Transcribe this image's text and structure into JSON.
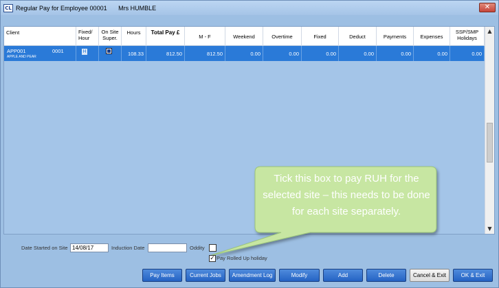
{
  "window": {
    "app_icon": "CL",
    "title": "Regular Pay for Employee 00001",
    "employee_name": "Mrs HUMBLE",
    "close_icon": "close-icon"
  },
  "grid": {
    "headers": {
      "client": "Client",
      "fixed_hour": "Fixed/ Hour",
      "on_site": "On Site Super.",
      "hours": "Hours",
      "total_pay": "Total Pay £",
      "m_f": "M - F",
      "weekend": "Weekend",
      "overtime": "Overtime",
      "fixed": "Fixed",
      "deduct": "Deduct",
      "payments": "Payments",
      "expenses": "Expenses",
      "ssp_smp": "SSP/SMP Holidays"
    },
    "rows": [
      {
        "client_code": "APP001",
        "client_num": "0001",
        "client_name": "APPLE AND PEAR",
        "fixed_hour": "H",
        "on_site_super": true,
        "hours": "108.33",
        "total_pay": "812.50",
        "m_f": "812.50",
        "weekend": "0.00",
        "overtime": "0.00",
        "fixed": "0.00",
        "deduct": "0.00",
        "payments": "0.00",
        "expenses": "0.00",
        "ssp_smp": "0.00"
      }
    ],
    "scroll_up": "▲",
    "scroll_down": "▼"
  },
  "fields": {
    "date_started_label": "Date Started on Site",
    "date_started_value": "14/08/17",
    "induction_label": "Induction Date",
    "induction_value": "",
    "oddity_label": "Oddity",
    "oddity_checked": false,
    "ruh_label": "Pay Rolled Up holiday",
    "ruh_checked": true,
    "ruh_mark": "✓"
  },
  "callout": {
    "text": "Tick this box to pay RUH for the selected site – this needs to be done for each site separately.",
    "fill_color": "#c7e6a2"
  },
  "buttons": {
    "pay_items": "Pay Items",
    "current_jobs": "Current Jobs",
    "amendment_log": "Amendment Log",
    "modify": "Modify",
    "add": "Add",
    "delete": "Delete",
    "cancel_exit": "Cancel & Exit",
    "ok_exit": "OK & Exit"
  }
}
